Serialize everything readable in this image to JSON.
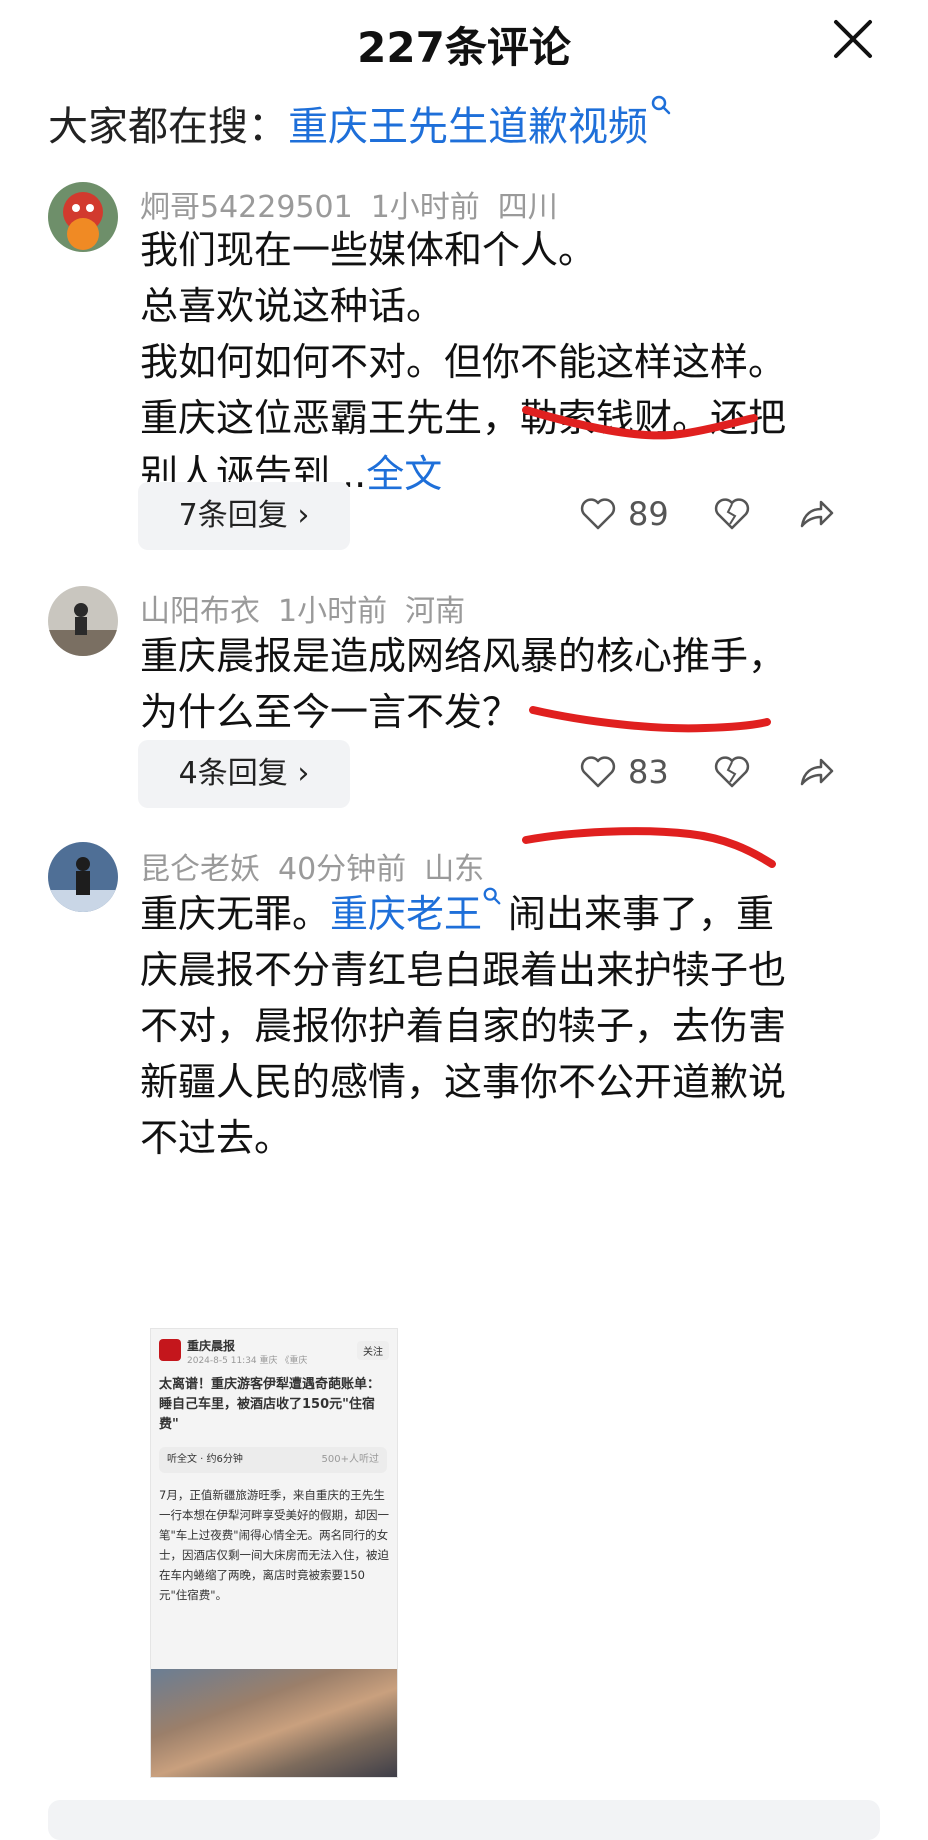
{
  "header": {
    "title": "227条评论"
  },
  "search": {
    "prefix": "大家都在搜：",
    "keyword": "重庆王先生道歉视频"
  },
  "comments": [
    {
      "username": "炯哥54229501",
      "time": "1小时前",
      "location": "四川",
      "lines": [
        "我们现在一些媒体和个人。",
        "总喜欢说这种话。",
        "我如何如何不对。但你不能这样这样。",
        "重庆这位恶霸王先生，勒索钱财。还把",
        "别人诬告到..."
      ],
      "more_link": "全文",
      "replies_label": "7条回复",
      "likes": "89"
    },
    {
      "username": "山阳布衣",
      "time": "1小时前",
      "location": "河南",
      "lines": [
        "重庆晨报是造成网络风暴的核心推手，",
        "为什么至今一言不发？"
      ],
      "replies_label": "4条回复",
      "likes": "83"
    },
    {
      "username": "昆仑老妖",
      "time": "40分钟前",
      "location": "山东",
      "text_before": "重庆无罪。",
      "link_text": "重庆老王",
      "text_after": "闹出来事了，重",
      "lines": [
        "庆晨报不分青红皂白跟着出来护犊子也",
        "不对，晨报你护着自家的犊子，去伤害",
        "新疆人民的感情，这事你不公开道歉说",
        "不过去。"
      ]
    }
  ],
  "thumbnail": {
    "source": "重庆晨报",
    "date": "2024-8-5 11:34 重庆 《重庆",
    "follow": "关注",
    "title": "太离谱！重庆游客伊犁遭遇奇葩账单：睡自己车里，被酒店收了150元\"住宿费\"",
    "listen": "听全文 · 约6分钟",
    "listeners": "500+人听过",
    "text": "7月，正值新疆旅游旺季，来自重庆的王先生一行本想在伊犁河畔享受美好的假期，却因一笔\"车上过夜费\"闹得心情全无。两名同行的女士，因酒店仅剩一间大床房而无法入住，被迫在车内蜷缩了两晚，离店时竟被索要150元\"住宿费\"。"
  },
  "colors": {
    "link": "#1e6fd9",
    "underline": "#e0201f",
    "meta": "#9a9a9a"
  }
}
